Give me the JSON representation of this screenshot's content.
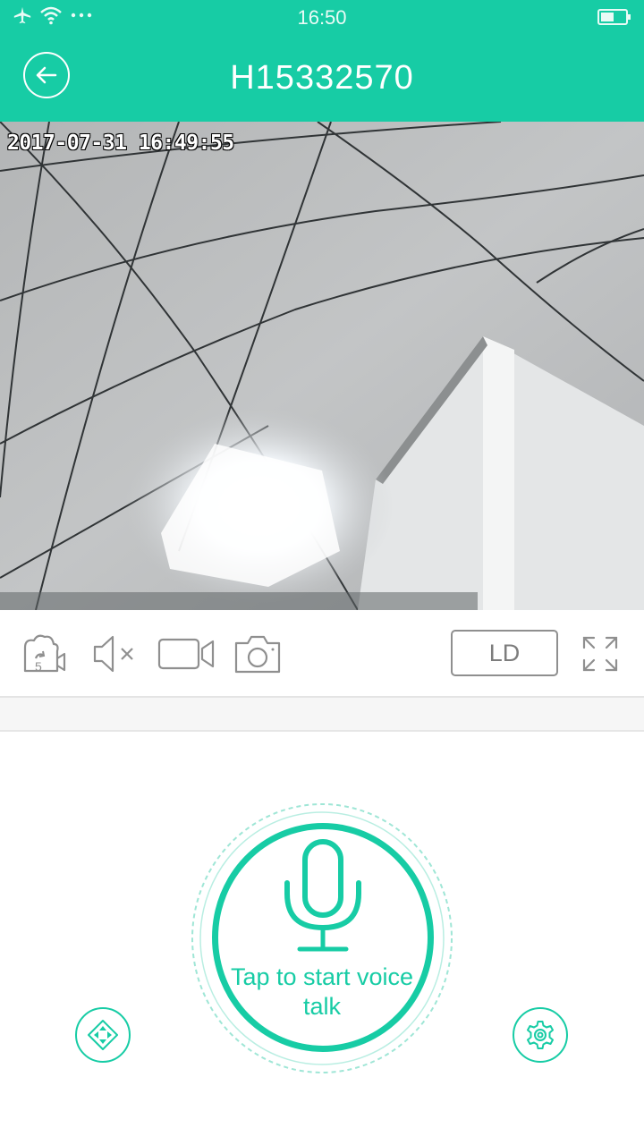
{
  "status_bar": {
    "time": "16:50",
    "icons": [
      "airplane-icon",
      "wifi-icon",
      "more-dots-icon",
      "battery-icon"
    ]
  },
  "header": {
    "title": "H15332570",
    "back_icon": "arrow-left-icon"
  },
  "video": {
    "timestamp": "2017-07-31 16:49:55"
  },
  "toolbar": {
    "tools": [
      "playback-icon",
      "mute-icon",
      "record-icon",
      "snapshot-icon"
    ],
    "quality_label": "LD",
    "fullscreen_icon": "expand-icon"
  },
  "voice_talk": {
    "label": "Tap to start voice talk",
    "icon": "microphone-icon"
  },
  "bottom": {
    "left_icon": "ptz-direction-icon",
    "right_icon": "settings-icon"
  },
  "colors": {
    "accent": "#17cca5",
    "icon_gray": "#8f8f8f",
    "background": "#ffffff"
  }
}
